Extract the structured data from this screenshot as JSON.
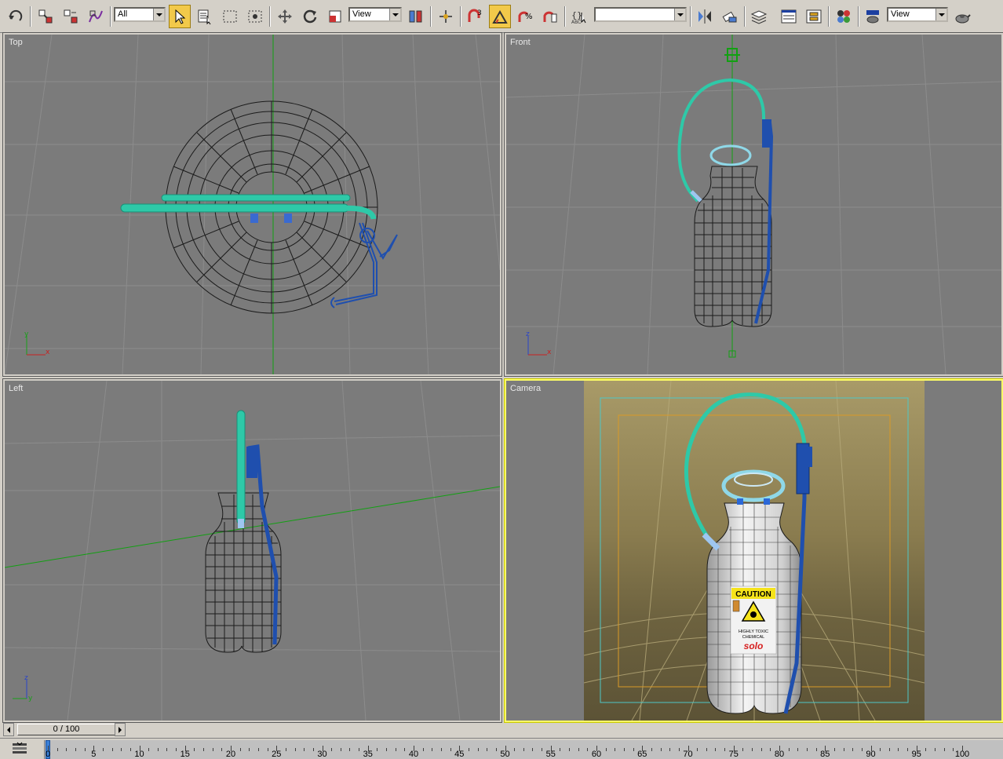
{
  "toolbar": {
    "selection_filter": "All",
    "ref_coord_1": "View",
    "named_selection": "",
    "ref_coord_2": "View",
    "icons": [
      "undo-icon",
      "select-and-link-icon",
      "unlink-icon",
      "bind-space-warp-icon",
      "select-object-icon",
      "select-by-name-icon",
      "rect-selection-icon",
      "window-crossing-icon",
      "move-icon",
      "rotate-icon",
      "scale-icon",
      "pivot-center-icon",
      "manipulate-icon",
      "snap-3d-icon",
      "angle-snap-icon",
      "percent-snap-icon",
      "spinner-snap-icon",
      "named-selection-icon",
      "mirror-icon",
      "align-icon",
      "layer-manager-icon",
      "curve-editor-icon",
      "schematic-view-icon",
      "material-editor-icon",
      "render-scene-icon",
      "quick-render-icon"
    ]
  },
  "viewports": {
    "top": {
      "label": "Top",
      "axis_a": "y",
      "axis_b": "x"
    },
    "front": {
      "label": "Front",
      "axis_a": "z",
      "axis_b": "x"
    },
    "left": {
      "label": "Left",
      "axis_a": "z",
      "axis_b": "y"
    },
    "camera": {
      "label": "Camera",
      "caution_text": "CAUTION",
      "hazard_text_1": "HIGHLY TOXIC",
      "hazard_text_2": "CHEMICAL",
      "brand_text": "solo"
    }
  },
  "timeslider": {
    "frame_display": "0 / 100",
    "current_frame": 0,
    "total_frames": 100
  },
  "trackbar": {
    "tick_labels": [
      "0",
      "5",
      "10",
      "15",
      "20",
      "25",
      "30",
      "35",
      "40",
      "45",
      "50",
      "55",
      "60",
      "65",
      "70",
      "75",
      "80",
      "85",
      "90",
      "95",
      "100"
    ]
  },
  "colors": {
    "viewport_bg": "#7b7b7b",
    "wire": "#1b1b1b",
    "hose": "#2ec9a8",
    "wand": "#1f4fae",
    "active_border": "#ffff66",
    "safe_frame_cyan": "#4ec7c7",
    "safe_frame_orange": "#d99a27"
  }
}
